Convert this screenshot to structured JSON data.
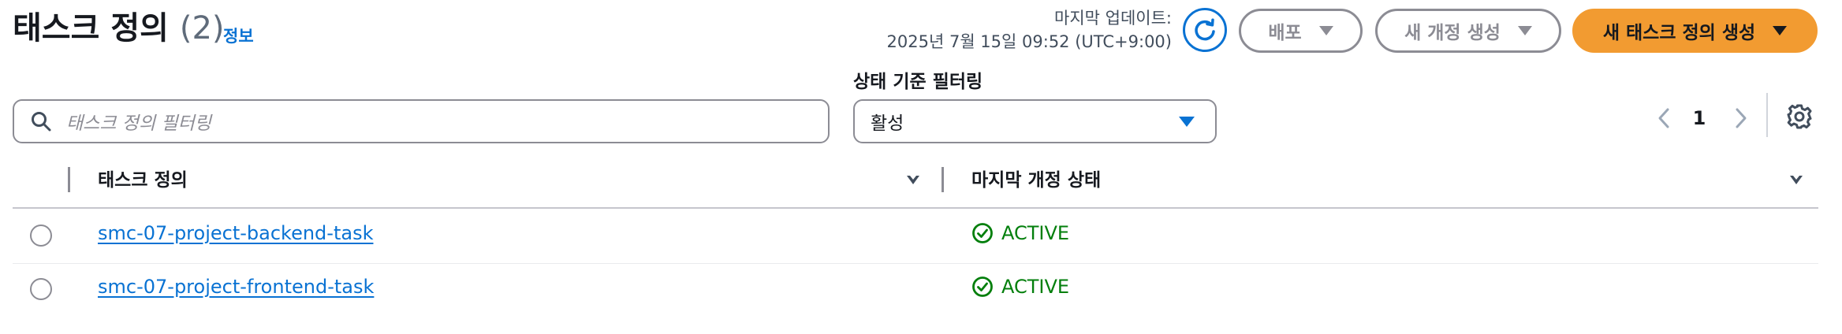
{
  "header": {
    "title": "태스크 정의",
    "count": "(2)",
    "info": "정보",
    "last_update_label": "마지막 업데이트:",
    "last_update_value": "2025년 7월 15일 09:52 (UTC+9:00)",
    "deploy_label": "배포",
    "new_revision_label": "새 개정 생성",
    "create_label": "새 태스크 정의 생성"
  },
  "filters": {
    "search_placeholder": "태스크 정의 필터링",
    "status_label": "상태 기준 필터링",
    "status_value": "활성"
  },
  "pagination": {
    "current_page": "1"
  },
  "table": {
    "columns": [
      "태스크 정의",
      "마지막 개정 상태"
    ],
    "rows": [
      {
        "name": "smc-07-project-backend-task",
        "status": "ACTIVE"
      },
      {
        "name": "smc-07-project-frontend-task",
        "status": "ACTIVE"
      }
    ]
  },
  "colors": {
    "accent": "#0972d3",
    "primary_button": "#f29b31",
    "status_active": "#037f0c"
  },
  "icons": [
    "refresh-icon",
    "search-icon",
    "chevron-left-icon",
    "chevron-right-icon",
    "settings-icon",
    "status-check-icon"
  ]
}
